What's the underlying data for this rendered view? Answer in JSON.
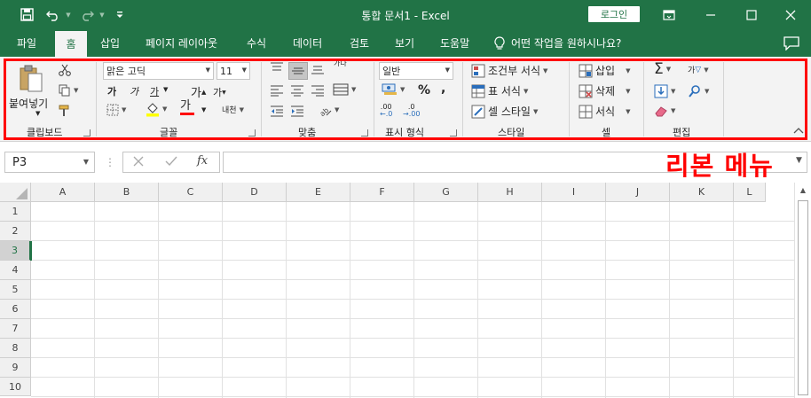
{
  "titlebar": {
    "title": "통합 문서1  -  Excel",
    "login_label": "로그인",
    "icons": [
      "save-icon",
      "undo-icon",
      "redo-icon",
      "customize-qat-icon",
      "ribbon-display-icon",
      "minimize-icon",
      "maximize-icon",
      "close-icon"
    ]
  },
  "tabs": {
    "file": "파일",
    "home": "홈",
    "insert": "삽입",
    "page_layout": "페이지 레이아웃",
    "formulas": "수식",
    "data": "데이터",
    "review": "검토",
    "view": "보기",
    "help": "도움말",
    "tell_me": "어떤 작업을 원하시나요?"
  },
  "ribbon": {
    "clipboard": {
      "label": "클립보드",
      "paste": "붙여넣기"
    },
    "font": {
      "label": "글꼴",
      "font_name": "맑은 고딕",
      "font_size": "11",
      "bold": "가",
      "italic": "가",
      "underline": "가",
      "grow": "가",
      "shrink": "가",
      "font_color": "가",
      "phonetic": "내천"
    },
    "alignment": {
      "label": "맞춤",
      "wrap": "가나"
    },
    "number": {
      "label": "표시 형식",
      "format": "일반",
      "percent": "%",
      "comma": ",",
      "inc_decimal": ".00",
      "dec_decimal": ".0"
    },
    "styles": {
      "label": "스타일",
      "conditional": "조건부 서식",
      "table": "표 서식",
      "cell_style": "셀 스타일"
    },
    "cells": {
      "label": "셀",
      "insert": "삽입",
      "delete": "삭제",
      "format": "서식"
    },
    "editing": {
      "label": "편집",
      "sort": "가",
      "sigma": "Σ"
    }
  },
  "formula_bar": {
    "name_box": "P3",
    "fx": "fx",
    "value": ""
  },
  "annotation": "리본 메뉴",
  "grid": {
    "columns": [
      "A",
      "B",
      "C",
      "D",
      "E",
      "F",
      "G",
      "H",
      "I",
      "J",
      "K",
      "L"
    ],
    "rows": [
      "1",
      "2",
      "3",
      "4",
      "5",
      "6",
      "7",
      "8",
      "9",
      "10"
    ],
    "selected_row": "3"
  },
  "colors": {
    "brand": "#217346",
    "highlight": "#ff0000",
    "font_color_bar": "#ff0000",
    "fill_color_bar": "#ffff00"
  }
}
